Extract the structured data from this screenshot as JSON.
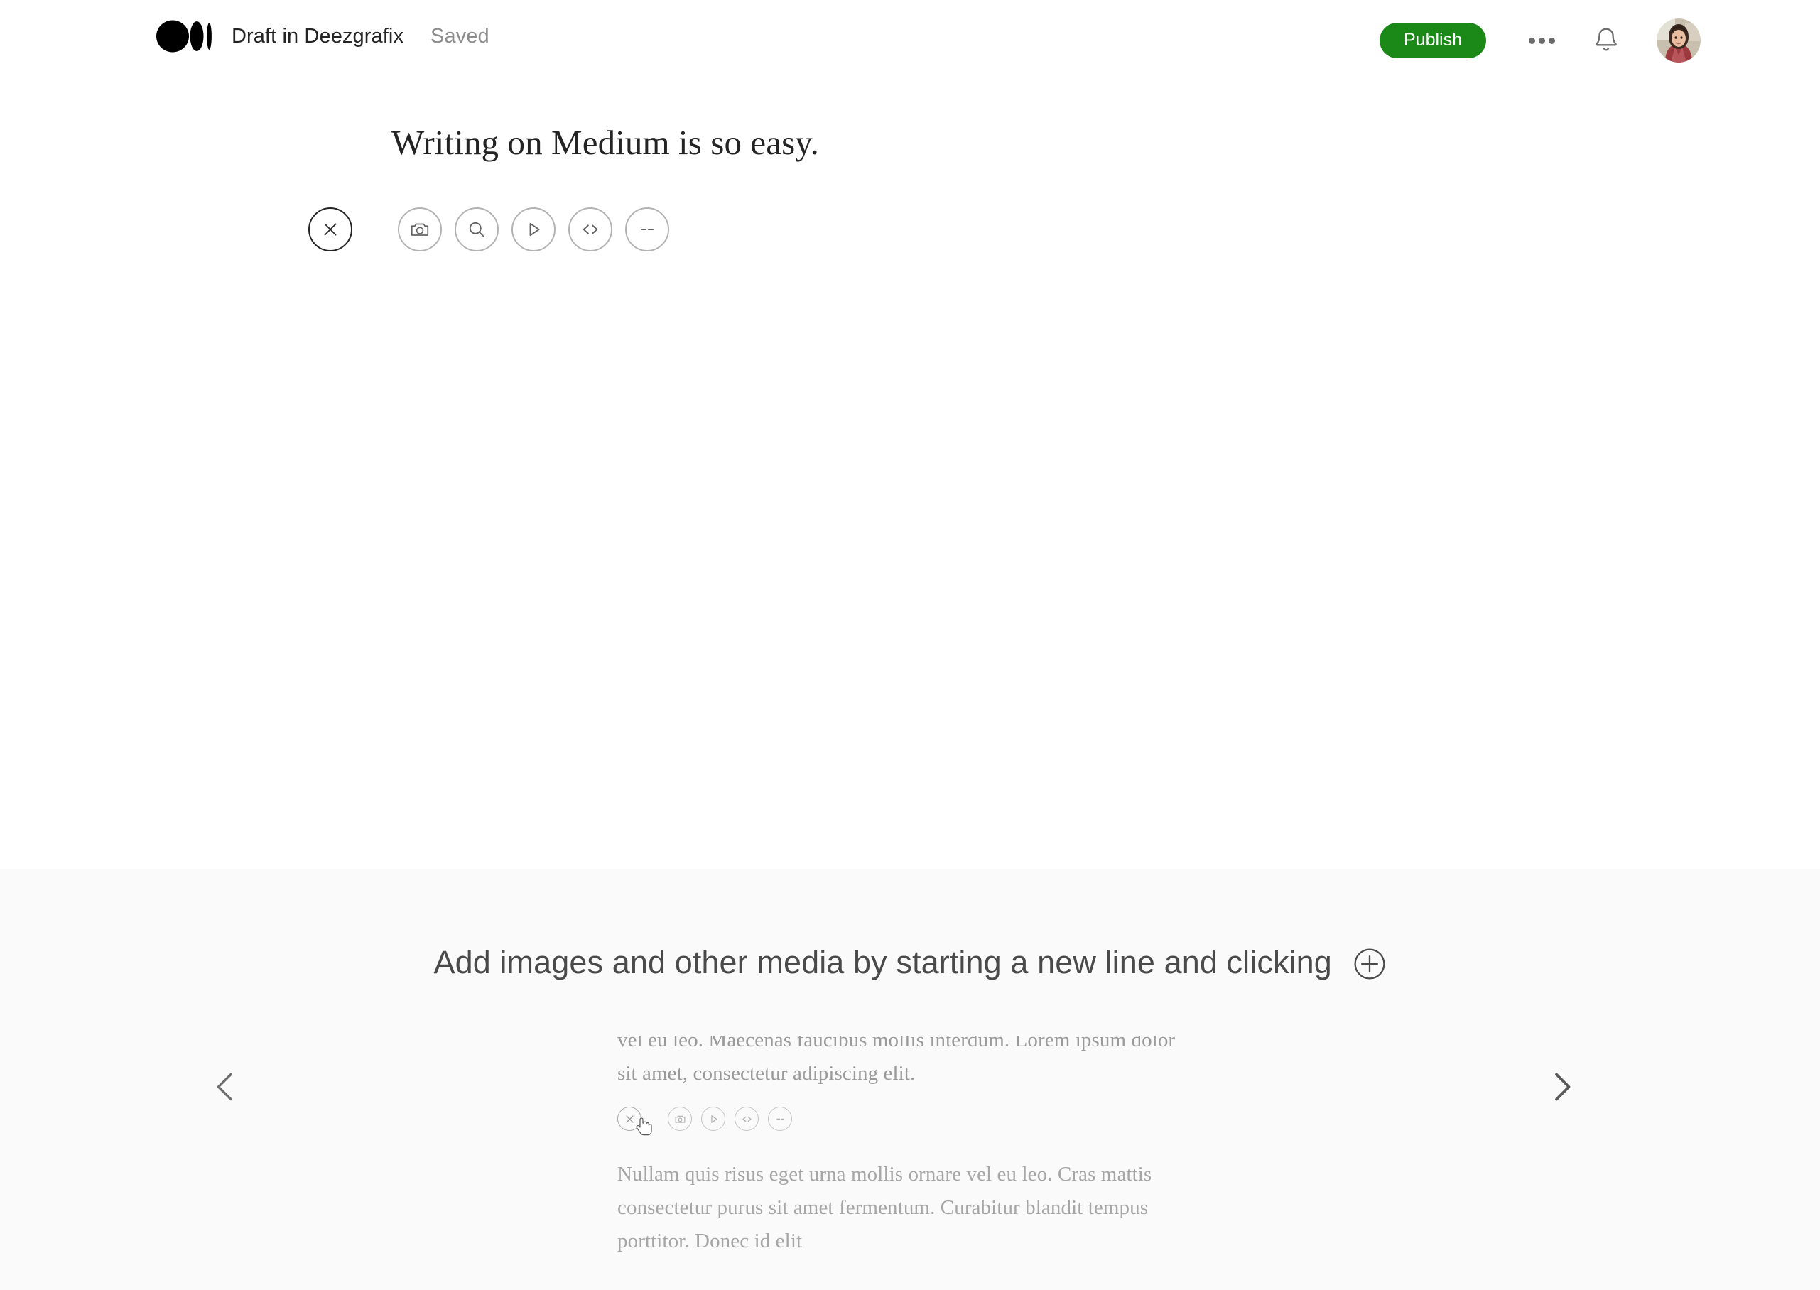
{
  "topbar": {
    "logo_icon": "medium-logo-icon",
    "draft_title": "Draft in Deezgrafix",
    "save_status": "Saved",
    "publish_label": "Publish",
    "more_icon": "more-horizontal-icon",
    "notifications_icon": "bell-icon",
    "avatar_icon": "user-avatar",
    "publish_color": "#1a8917"
  },
  "editor": {
    "headline": "Writing on Medium is so easy.",
    "toolbar": {
      "items": [
        {
          "icon": "close-icon",
          "label": "Close"
        },
        {
          "icon": "camera-icon",
          "label": "Add image"
        },
        {
          "icon": "search-icon",
          "label": "Embed from Unsplash"
        },
        {
          "icon": "play-icon",
          "label": "Add video"
        },
        {
          "icon": "code-icon",
          "label": "Add code block"
        },
        {
          "icon": "divider-icon",
          "label": "Add part divider"
        }
      ]
    }
  },
  "promo": {
    "heading": "Add images and other media by starting a new line and clicking",
    "plus_icon": "plus-circle-icon",
    "prev_icon": "chevron-left-icon",
    "next_icon": "chevron-right-icon",
    "background_color": "#fafafa",
    "preview": {
      "text_top": "vel eu leo. Maecenas faucibus mollis interdum. Lorem ipsum dolor sit amet, consectetur adipiscing elit.",
      "text_bottom": "Nullam quis risus eget urna mollis ornare vel eu leo. Cras mattis consectetur purus sit amet fermentum. Curabitur blandit tempus porttitor. Donec id elit",
      "toolbar": {
        "items": [
          {
            "icon": "close-icon",
            "label": "Close"
          },
          {
            "icon": "camera-icon",
            "label": "Add image"
          },
          {
            "icon": "play-icon",
            "label": "Add video"
          },
          {
            "icon": "code-icon",
            "label": "Add code block"
          },
          {
            "icon": "divider-icon",
            "label": "Add part divider"
          }
        ]
      },
      "cursor_icon": "pointer-hand-cursor"
    }
  }
}
